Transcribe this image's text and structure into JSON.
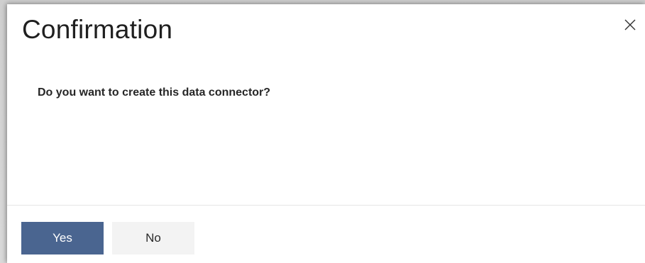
{
  "dialog": {
    "title": "Confirmation",
    "message": "Do you want to create this data connector?",
    "close_icon": "close-icon",
    "buttons": {
      "yes_label": "Yes",
      "no_label": "No"
    },
    "colors": {
      "primary_button": "#4a6590",
      "secondary_button": "#f3f3f3"
    }
  }
}
